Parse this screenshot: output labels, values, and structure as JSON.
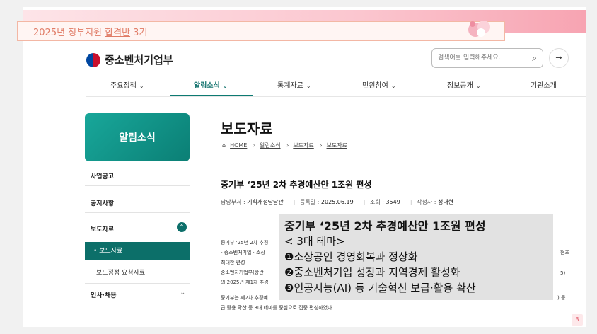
{
  "banner": {
    "text_prefix": "2025년 정부지원 ",
    "text_highlight": "합격반",
    "text_suffix": " 3기"
  },
  "header": {
    "logo_text": "중소벤처기업부",
    "search_placeholder": "검색어를 입력해주세요.",
    "more_label": "→"
  },
  "nav": {
    "items": [
      {
        "label": "주요정책"
      },
      {
        "label": "알림소식"
      },
      {
        "label": "통계자료"
      },
      {
        "label": "민원참여"
      },
      {
        "label": "정보공개"
      },
      {
        "label": "기관소개"
      }
    ],
    "chevron": "⌄"
  },
  "sidebar": {
    "title": "알림소식",
    "items": [
      {
        "label": "사업공고"
      },
      {
        "label": "공지사항"
      },
      {
        "label": "보도자료"
      },
      {
        "label": "인사·채용"
      }
    ],
    "active_sub": "• 보도자료",
    "sub": "보도정정 요청자료"
  },
  "content": {
    "page_title": "보도자료",
    "breadcrumb": [
      "HOME",
      "알림소식",
      "보도자료",
      "보도자료"
    ],
    "article_title": "중기부 ‘25년 2차 추경예산안 1조원 편성",
    "meta": {
      "dept_label": "담당부서 :",
      "dept": "기획재정담당관",
      "date_label": "등록일 :",
      "date": "2025.06.19",
      "views_label": "조회 :",
      "views": "3549",
      "author_label": "작성자 :",
      "author": "성대현"
    },
    "body_lines": [
      "중기부 ‘25년 2차 추경",
      "- 중소벤처기업 · 소상",
      "최대한 편성",
      "중소벤처기업부(장관",
      "의 2025년 제1차 추경",
      "중기부는 제2차 추경예",
      "급·활용 확산 등 3대 테마를 중심으로 집중 편성하였다."
    ],
    "body_fragments": [
      "현즈",
      "5)",
      ") 등"
    ]
  },
  "overlay": {
    "title": "중기부 ‘25년 2차 추경예산안 1조원 편성",
    "lines": [
      "< 3대 테마>",
      "❶소상공인 경영회복과 정상화",
      "❷중소벤처기업 성장과 지역경제 활성화",
      "❸인공지능(AI) 등 기술혁신 보급·활용 확산"
    ]
  },
  "page_number": "3"
}
